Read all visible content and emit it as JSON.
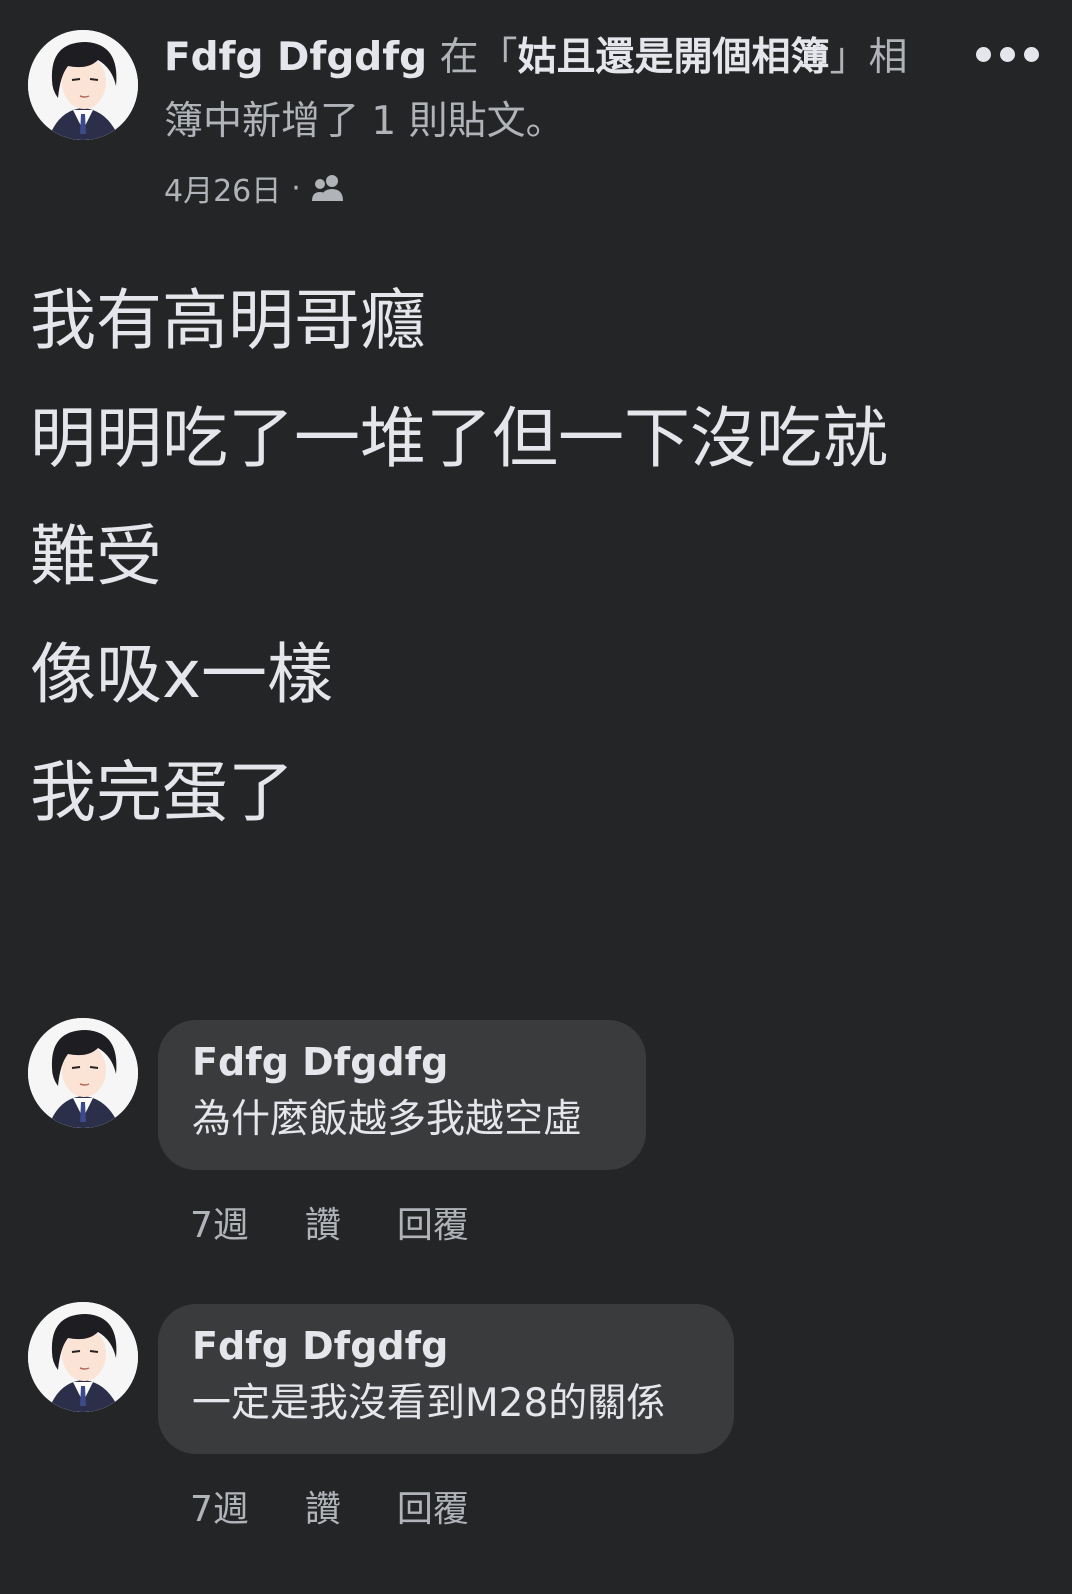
{
  "post": {
    "author": "Fdfg Dfgdfg",
    "connector_before": " 在「",
    "album": "姑且還是開個相簿",
    "connector_after": "」相簿中新增了 1 則貼文。",
    "date": "4月26日",
    "separator": "·",
    "privacy_icon": "friends-icon",
    "more_icon": "more-icon",
    "lines": [
      "我有高明哥癮",
      "明明吃了一堆了但一下沒吃就",
      "難受",
      "像吸x一樣",
      "我完蛋了"
    ]
  },
  "comments": [
    {
      "author": "Fdfg Dfgdfg",
      "text": "為什麼飯越多我越空虛",
      "time": "7週",
      "like": "讚",
      "reply": "回覆"
    },
    {
      "author": "Fdfg Dfgdfg",
      "text": "一定是我沒看到M28的關係",
      "time": "7週",
      "like": "讚",
      "reply": "回覆"
    }
  ],
  "colors": {
    "background": "#242526",
    "bubble": "#3a3b3c",
    "primary_text": "#e4e6eb",
    "secondary_text": "#b0b3b8"
  }
}
